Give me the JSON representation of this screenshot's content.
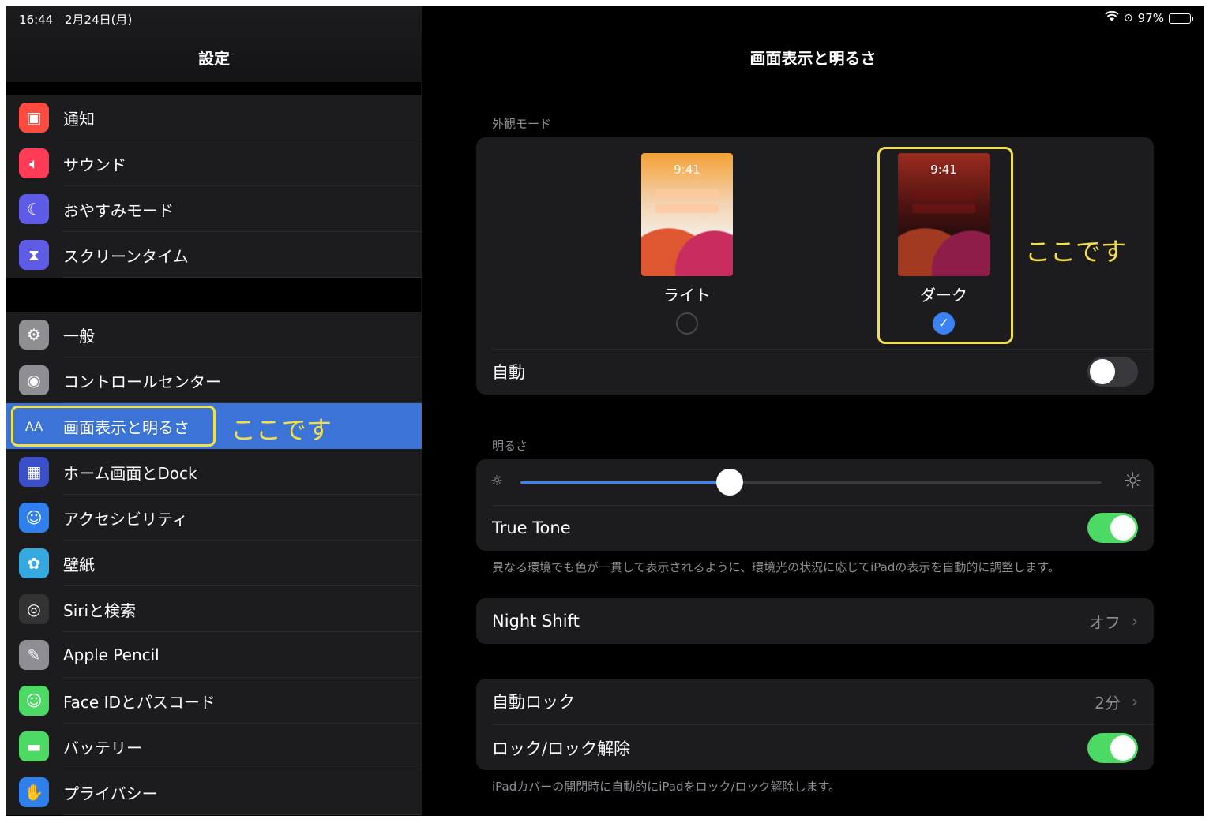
{
  "status_bar": {
    "time": "16:44",
    "date": "2月24日(月)",
    "battery": "97%",
    "battery_level": 0.97
  },
  "sidebar": {
    "title": "設定",
    "group1": [
      {
        "label": "通知",
        "icon": "notification-icon",
        "color": "#ff4a3f"
      },
      {
        "label": "サウンド",
        "icon": "speaker-icon",
        "color": "#ff3b55"
      },
      {
        "label": "おやすみモード",
        "icon": "moon-icon",
        "color": "#5e5ce6"
      },
      {
        "label": "スクリーンタイム",
        "icon": "hourglass-icon",
        "color": "#5e5ce6"
      }
    ],
    "group2": [
      {
        "label": "一般",
        "icon": "gear-icon",
        "color": "#8e8e93"
      },
      {
        "label": "コントロールセンター",
        "icon": "switches-icon",
        "color": "#8e8e93"
      },
      {
        "label": "画面表示と明るさ",
        "icon": "text-size-icon",
        "color": "#3b73d6",
        "selected": true
      },
      {
        "label": "ホーム画面とDock",
        "icon": "grid-icon",
        "color": "#3a4fc9"
      },
      {
        "label": "アクセシビリティ",
        "icon": "accessibility-icon",
        "color": "#2f80ed"
      },
      {
        "label": "壁紙",
        "icon": "flower-icon",
        "color": "#35a8e0"
      },
      {
        "label": "Siriと検索",
        "icon": "siri-icon",
        "color": "#333"
      },
      {
        "label": "Apple Pencil",
        "icon": "pencil-icon",
        "color": "#8e8e93"
      },
      {
        "label": "Face IDとパスコード",
        "icon": "face-id-icon",
        "color": "#4cd964"
      },
      {
        "label": "バッテリー",
        "icon": "battery-icon",
        "color": "#4cd964"
      },
      {
        "label": "プライバシー",
        "icon": "hand-icon",
        "color": "#2f80ed"
      }
    ],
    "annotation": "ここです"
  },
  "detail": {
    "title": "画面表示と明るさ",
    "appearance_label": "外観モード",
    "light": {
      "time": "9:41",
      "label": "ライト",
      "selected": false
    },
    "dark": {
      "time": "9:41",
      "label": "ダーク",
      "selected": true
    },
    "dark_annotation": "ここです",
    "auto_label": "自動",
    "auto_on": false,
    "brightness_label": "明るさ",
    "brightness_value": 0.36,
    "true_tone_label": "True Tone",
    "true_tone_on": true,
    "true_tone_note": "異なる環境でも色が一貫して表示されるように、環境光の状況に応じてiPadの表示を自動的に調整します。",
    "night_shift_label": "Night Shift",
    "night_shift_value": "オフ",
    "auto_lock_label": "自動ロック",
    "auto_lock_value": "2分",
    "lock_unlock_label": "ロック/ロック解除",
    "lock_unlock_on": true,
    "lock_note": "iPadカバーの開閉時に自動的にiPadをロック/ロック解除します。"
  }
}
